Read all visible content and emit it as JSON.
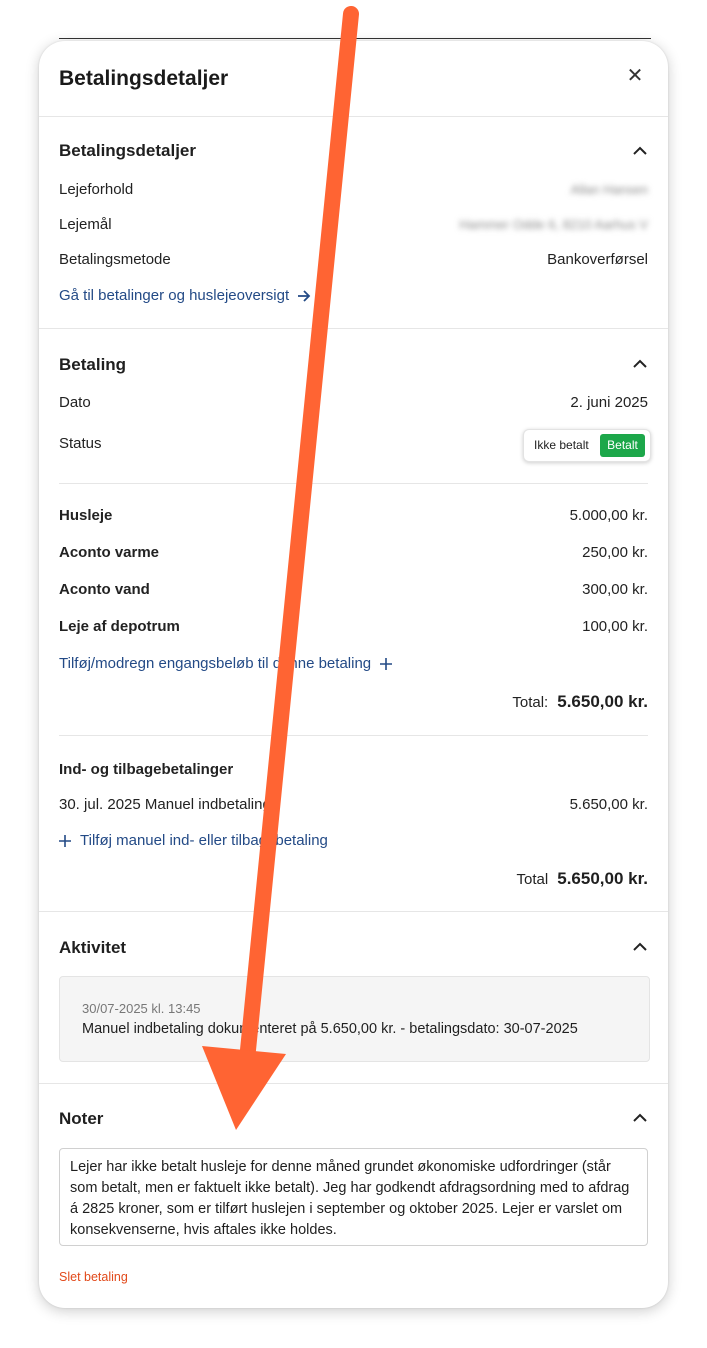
{
  "modal": {
    "title": "Betalingsdetaljer",
    "close_icon": "close-icon"
  },
  "payment_details": {
    "section_title": "Betalingsdetaljer",
    "tenancy_label": "Lejeforhold",
    "tenancy_value": "Allan Hansen",
    "lease_label": "Lejemål",
    "lease_value": "Hammer Odde 6, 8210 Aarhus V",
    "method_label": "Betalingsmetode",
    "method_value": "Bankoverførsel",
    "goto_link": "Gå til betalinger og huslejeoversigt"
  },
  "payment": {
    "section_title": "Betaling",
    "date_label": "Dato",
    "date_value": "2. juni 2025",
    "status_label": "Status",
    "status_unpaid": "Ikke betalt",
    "status_paid": "Betalt",
    "status_selected": "Betalt",
    "lines": [
      {
        "label": "Husleje",
        "amount": "5.000,00 kr."
      },
      {
        "label": "Aconto varme",
        "amount": "250,00 kr."
      },
      {
        "label": "Aconto vand",
        "amount": "300,00 kr."
      },
      {
        "label": "Leje af depotrum",
        "amount": "100,00 kr."
      }
    ],
    "add_link": "Tilføj/modregn engangsbeløb til denne betaling",
    "total_label": "Total:",
    "total_value": "5.650,00 kr."
  },
  "transactions": {
    "title": "Ind- og tilbagebetalinger",
    "rows": [
      {
        "description": "30. jul. 2025 Manuel indbetaling",
        "amount": "5.650,00 kr."
      }
    ],
    "add_link": "Tilføj manuel ind- eller tilbagebetaling",
    "total_label": "Total",
    "total_value": "5.650,00 kr."
  },
  "activity": {
    "section_title": "Aktivitet",
    "entries": [
      {
        "time": "30/07-2025 kl. 13:45",
        "text": "Manuel indbetaling dokumenteret på 5.650,00 kr. - betalingsdato: 30-07-2025"
      }
    ]
  },
  "notes": {
    "section_title": "Noter",
    "text": "Lejer har ikke betalt husleje for denne måned grundet økonomiske udfordringer (står som betalt, men er faktuelt ikke betalt). Jeg har godkendt afdragsordning med to afdrag á 2825 kroner, som er tilført huslejen i september og oktober 2025. Lejer er varslet om konsekvenserne, hvis aftales ikke holdes."
  },
  "delete_label": "Slet betaling",
  "colors": {
    "link": "#234a86",
    "paid_green": "#1ca74a",
    "delete_red": "#e24a1b",
    "annotation_arrow": "#ff6433"
  }
}
